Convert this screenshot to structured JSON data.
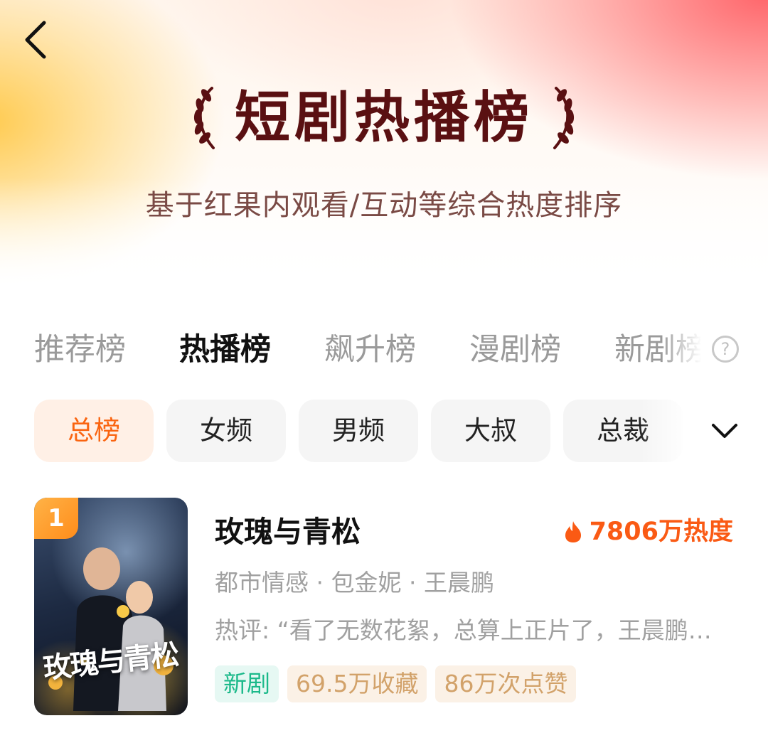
{
  "header": {
    "title": "短剧热播榜",
    "subtitle": "基于红果内观看/互动等综合热度排序"
  },
  "tabs": [
    {
      "label": "推荐榜",
      "active": false
    },
    {
      "label": "热播榜",
      "active": true
    },
    {
      "label": "飙升榜",
      "active": false
    },
    {
      "label": "漫剧榜",
      "active": false
    },
    {
      "label": "新剧榜",
      "active": false
    }
  ],
  "filters": [
    {
      "label": "总榜",
      "active": true
    },
    {
      "label": "女频",
      "active": false
    },
    {
      "label": "男频",
      "active": false
    },
    {
      "label": "大叔",
      "active": false
    },
    {
      "label": "总裁",
      "active": false
    }
  ],
  "items": [
    {
      "rank": "1",
      "name": "玫瑰与青松",
      "heat": "7806万热度",
      "meta": "都市情感 · 包金妮 · 王晨鹏",
      "review": "热评: “看了无数花絮，总算上正片了，王晨鹏和包金妮的感情戏太好看了",
      "poster_title": "玫瑰与青松",
      "tags": {
        "new": "新剧",
        "favorites": "69.5万收藏",
        "likes": "86万次点赞"
      }
    }
  ],
  "icons": {
    "back": "chevron-left-icon",
    "help": "question-circle-icon",
    "expand": "chevron-down-icon",
    "heat": "flame-icon"
  },
  "colors": {
    "accent": "#fa6410",
    "title": "#5a1012",
    "new_tag": "#1bb98a",
    "stat_tag": "#d2a26a"
  }
}
